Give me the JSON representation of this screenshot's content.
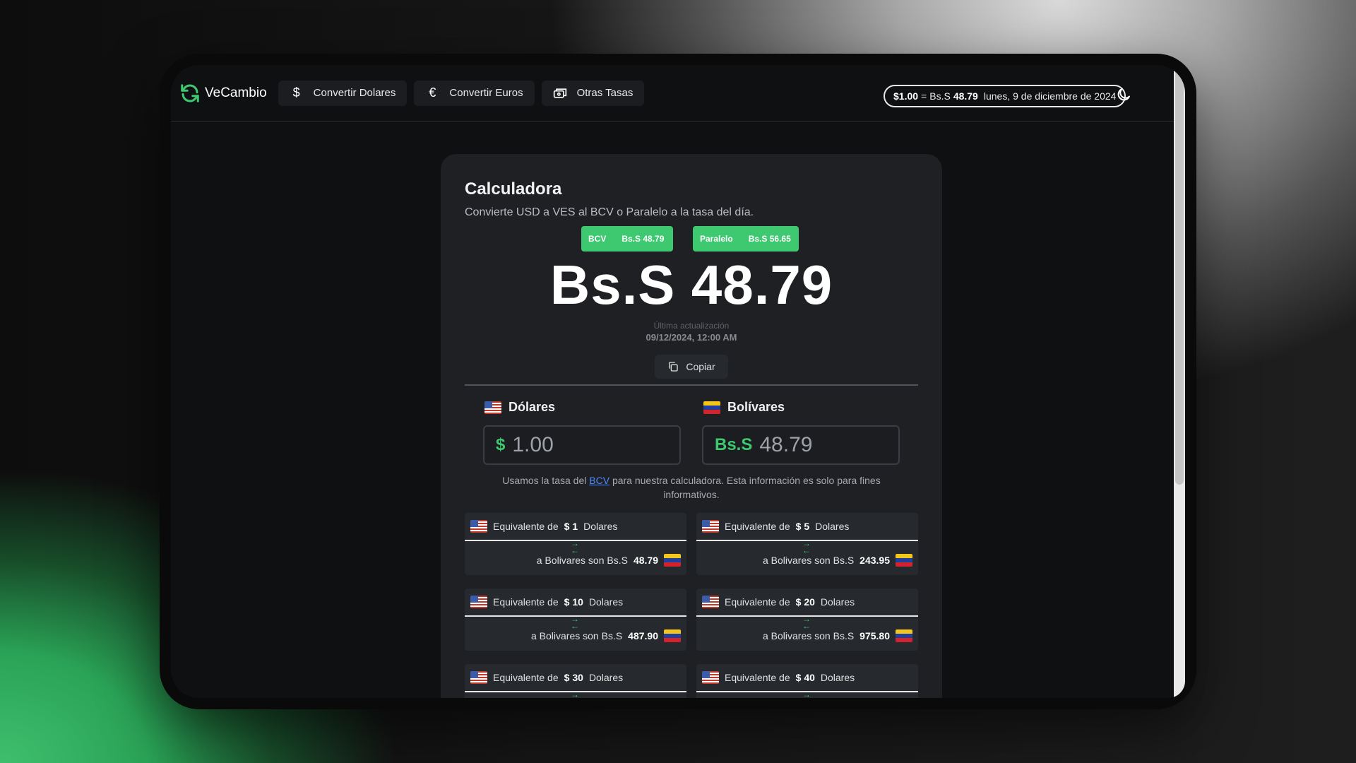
{
  "brand": {
    "name": "VeCambio"
  },
  "nav": [
    {
      "icon": "dollar-icon",
      "label": "Convertir Dolares"
    },
    {
      "icon": "euro-icon",
      "label": "Convertir Euros"
    },
    {
      "icon": "exchange-icon",
      "label": "Otras Tasas"
    }
  ],
  "header_rate": {
    "usd": "$1.00",
    "eq": "=",
    "prefix": "Bs.S",
    "value": "48.79",
    "date": "lunes, 9 de diciembre de 2024"
  },
  "calculator": {
    "title": "Calculadora",
    "subtitle": "Convierte USD a VES al BCV o Paralelo a la tasa del día.",
    "tags": [
      {
        "name": "BCV",
        "value": "Bs.S 48.79"
      },
      {
        "name": "Paralelo",
        "value": "Bs.S 56.65"
      }
    ],
    "big_rate": "Bs.S 48.79",
    "updated_label": "Última actualización",
    "updated_date": "09/12/2024, 12:00 AM",
    "copy_label": "Copiar",
    "usd": {
      "label": "Dólares",
      "prefix": "$",
      "value": "1.00"
    },
    "ves": {
      "label": "Bolívares",
      "prefix": "Bs.S",
      "value": "48.79"
    },
    "note_pre": "Usamos la tasa del",
    "note_link": "BCV",
    "note_post": "para nuestra calculadora. Esta información es solo para fines informativos."
  },
  "equivalents": [
    {
      "top_pre": "Equivalente de",
      "amount": "$ 1",
      "top_post": "Dolares",
      "bottom_pre": "a Bolivares son Bs.S",
      "result": "48.79"
    },
    {
      "top_pre": "Equivalente de",
      "amount": "$ 5",
      "top_post": "Dolares",
      "bottom_pre": "a Bolivares son Bs.S",
      "result": "243.95"
    },
    {
      "top_pre": "Equivalente de",
      "amount": "$ 10",
      "top_post": "Dolares",
      "bottom_pre": "a Bolivares son Bs.S",
      "result": "487.90"
    },
    {
      "top_pre": "Equivalente de",
      "amount": "$ 20",
      "top_post": "Dolares",
      "bottom_pre": "a Bolivares son Bs.S",
      "result": "975.80"
    },
    {
      "top_pre": "Equivalente de",
      "amount": "$ 30",
      "top_post": "Dolares",
      "bottom_pre": "",
      "result": ""
    },
    {
      "top_pre": "Equivalente de",
      "amount": "$ 40",
      "top_post": "Dolares",
      "bottom_pre": "",
      "result": ""
    }
  ],
  "colors": {
    "accent": "#3ec870",
    "card": "#1e2024",
    "page": "#0f1012",
    "link": "#4d8cff"
  }
}
